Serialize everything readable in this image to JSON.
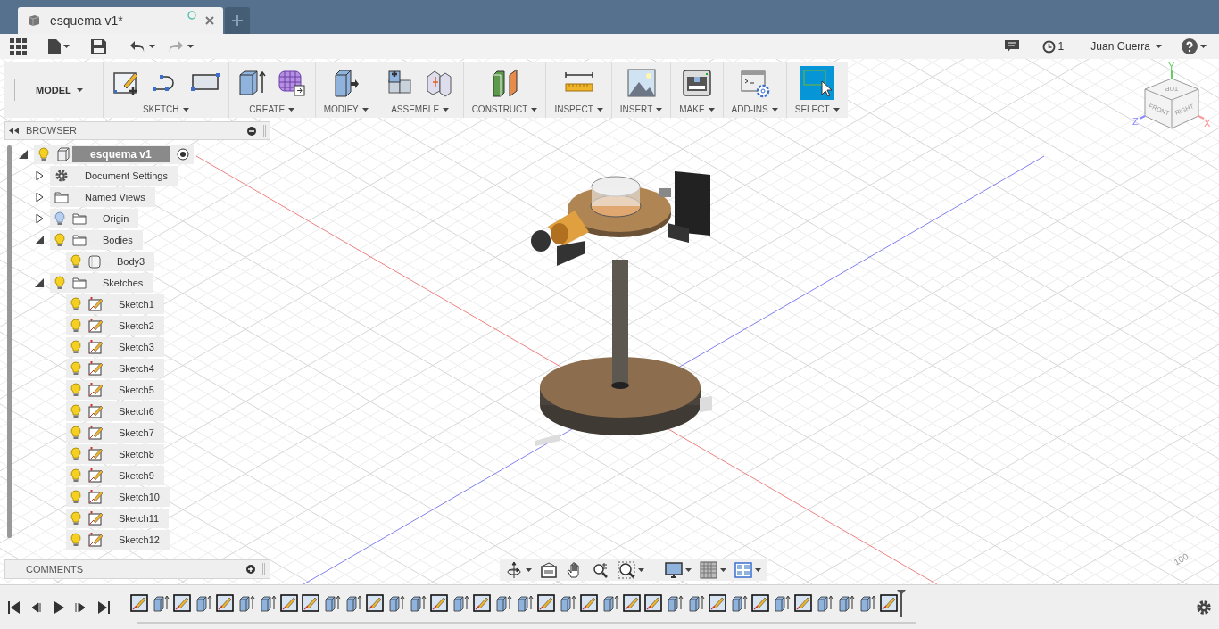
{
  "document_tab": {
    "title": "esquema v1*"
  },
  "top_bar": {
    "recent_count": "1",
    "user": "Juan Guerra"
  },
  "ribbon": {
    "workspace": "MODEL",
    "groups": [
      {
        "label": "SKETCH",
        "selected": false,
        "tools": [
          {
            "kind": "sketch"
          },
          {
            "kind": "spline"
          },
          {
            "kind": "rectangle"
          }
        ]
      },
      {
        "label": "CREATE",
        "selected": false,
        "tools": [
          {
            "kind": "extrude"
          },
          {
            "kind": "form"
          }
        ]
      },
      {
        "label": "MODIFY",
        "selected": false,
        "tools": [
          {
            "kind": "pushpull"
          }
        ]
      },
      {
        "label": "ASSEMBLE",
        "selected": false,
        "tools": [
          {
            "kind": "component"
          },
          {
            "kind": "joint"
          }
        ]
      },
      {
        "label": "CONSTRUCT",
        "selected": false,
        "tools": [
          {
            "kind": "plane"
          }
        ]
      },
      {
        "label": "INSPECT",
        "selected": false,
        "tools": [
          {
            "kind": "measure"
          }
        ]
      },
      {
        "label": "INSERT",
        "selected": false,
        "tools": [
          {
            "kind": "image"
          }
        ]
      },
      {
        "label": "MAKE",
        "selected": false,
        "tools": [
          {
            "kind": "printer"
          }
        ]
      },
      {
        "label": "ADD-INS",
        "selected": false,
        "tools": [
          {
            "kind": "scripts"
          }
        ]
      },
      {
        "label": "SELECT",
        "selected": true,
        "tools": [
          {
            "kind": "select"
          }
        ]
      }
    ]
  },
  "browser": {
    "title": "BROWSER",
    "tree": [
      {
        "label": "esquema v1",
        "kind": "root",
        "visible": true,
        "expanded": true,
        "active": true,
        "children": [
          {
            "label": "Document Settings",
            "kind": "settings",
            "expanded": false
          },
          {
            "label": "Named Views",
            "kind": "folder",
            "expanded": false
          },
          {
            "label": "Origin",
            "kind": "folder",
            "visible": false,
            "expanded": false
          },
          {
            "label": "Bodies",
            "kind": "folder",
            "visible": true,
            "expanded": true,
            "children": [
              {
                "label": "Body3",
                "kind": "body",
                "visible": true
              }
            ]
          },
          {
            "label": "Sketches",
            "kind": "folder",
            "visible": true,
            "expanded": true,
            "children": [
              {
                "label": "Sketch1",
                "kind": "sketch",
                "visible": true
              },
              {
                "label": "Sketch2",
                "kind": "sketch",
                "visible": true
              },
              {
                "label": "Sketch3",
                "kind": "sketch",
                "visible": true
              },
              {
                "label": "Sketch4",
                "kind": "sketch",
                "visible": true
              },
              {
                "label": "Sketch5",
                "kind": "sketch",
                "visible": true
              },
              {
                "label": "Sketch6",
                "kind": "sketch",
                "visible": true
              },
              {
                "label": "Sketch7",
                "kind": "sketch",
                "visible": true
              },
              {
                "label": "Sketch8",
                "kind": "sketch",
                "visible": true
              },
              {
                "label": "Sketch9",
                "kind": "sketch",
                "visible": true
              },
              {
                "label": "Sketch10",
                "kind": "sketch",
                "visible": true
              },
              {
                "label": "Sketch11",
                "kind": "sketch",
                "visible": true
              },
              {
                "label": "Sketch12",
                "kind": "sketch",
                "visible": true
              }
            ]
          }
        ]
      }
    ]
  },
  "comments": {
    "title": "COMMENTS"
  },
  "view_cube": {
    "top": "TOP",
    "front": "FRONT",
    "right": "RIGHT",
    "x": "X",
    "y": "Y",
    "z": "Z"
  },
  "viewport": {
    "grid_label": "100"
  },
  "nav_bar": [
    {
      "kind": "orbit"
    },
    {
      "kind": "lookat"
    },
    {
      "kind": "pan"
    },
    {
      "kind": "zoom"
    },
    {
      "kind": "fit"
    },
    {
      "kind": "display"
    },
    {
      "kind": "grid"
    },
    {
      "kind": "viewports"
    }
  ],
  "timeline": [
    {
      "kind": "sketch"
    },
    {
      "kind": "extrude"
    },
    {
      "kind": "sketch"
    },
    {
      "kind": "extrude"
    },
    {
      "kind": "sketch"
    },
    {
      "kind": "extrude"
    },
    {
      "kind": "extrude"
    },
    {
      "kind": "sketch"
    },
    {
      "kind": "sketch"
    },
    {
      "kind": "extrude"
    },
    {
      "kind": "extrude"
    },
    {
      "kind": "sketch"
    },
    {
      "kind": "extrude"
    },
    {
      "kind": "extrude"
    },
    {
      "kind": "sketch"
    },
    {
      "kind": "extrude"
    },
    {
      "kind": "sketch"
    },
    {
      "kind": "extrude"
    },
    {
      "kind": "extrude"
    },
    {
      "kind": "sketch"
    },
    {
      "kind": "extrude"
    },
    {
      "kind": "sketch"
    },
    {
      "kind": "extrude"
    },
    {
      "kind": "sketch"
    },
    {
      "kind": "sketch"
    },
    {
      "kind": "extrude"
    },
    {
      "kind": "extrude"
    },
    {
      "kind": "sketch"
    },
    {
      "kind": "extrude"
    },
    {
      "kind": "sketch"
    },
    {
      "kind": "extrude"
    },
    {
      "kind": "sketch"
    },
    {
      "kind": "extrude"
    },
    {
      "kind": "extrude"
    },
    {
      "kind": "extrude"
    },
    {
      "kind": "sketch"
    }
  ]
}
